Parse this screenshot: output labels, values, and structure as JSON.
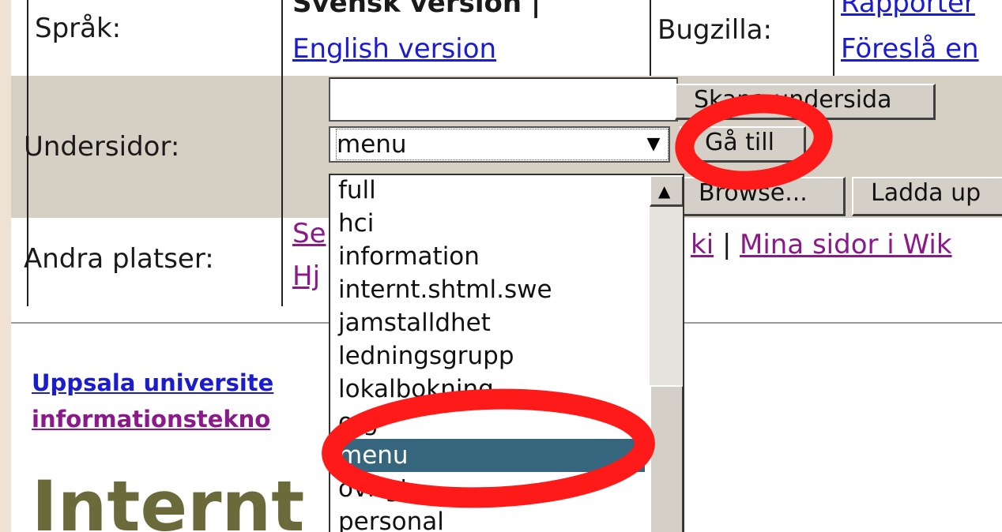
{
  "nav": {
    "language_label": "Språk:",
    "language_current": "Svensk version |",
    "language_english": "English version",
    "bugzilla_label": "Bugzilla:",
    "bugzilla_link1": "Rapporter",
    "bugzilla_link2": "Föreslå en",
    "subpages_label": "Undersidor:",
    "create_button": "Skapa undersida",
    "goto_button": "Gå till",
    "browse_button": "Browse...",
    "upload_button": "Ladda up",
    "other_label": "Andra platser:",
    "other_link1_left": "Se",
    "other_link1_right": "ki",
    "other_sep": "|",
    "other_link2": "Mina sidor i Wik",
    "other_link3": "Hj"
  },
  "select": {
    "new_page_value": "",
    "selected": "menu",
    "options": [
      "full",
      "hci",
      "information",
      "internt.shtml.swe",
      "jamstalldhet",
      "ledningsgrupp",
      "lokalbokning",
      "org",
      "menu",
      "övrigt",
      "personal"
    ],
    "selected_index": 8
  },
  "content": {
    "breadcrumb1": "Uppsala universite",
    "breadcrumb2": "informationstekno",
    "heading": "Internt"
  },
  "colors": {
    "annotation": "#ff1a1a",
    "selection": "#35667e",
    "header_band": "#d6cfc4",
    "heading": "#6a6a3a"
  }
}
